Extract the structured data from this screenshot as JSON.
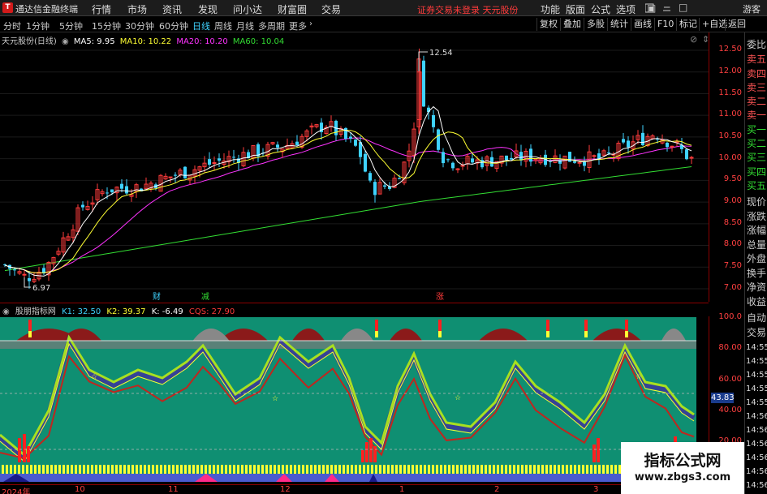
{
  "app": {
    "logo": "T",
    "title": "通达信金融终端"
  },
  "menu": [
    "行情",
    "市场",
    "资讯",
    "发现",
    "问小达",
    "财富圈",
    "交易"
  ],
  "login_status": "证券交易未登录 天元股份",
  "right_menu": [
    "功能",
    "版面",
    "公式",
    "选项"
  ],
  "guest": "游客",
  "periods": [
    "分时",
    "1分钟",
    "5分钟",
    "15分钟",
    "30分钟",
    "60分钟",
    "日线",
    "周线",
    "月线",
    "多周期",
    "更多"
  ],
  "active_period": "日线",
  "tools": [
    "复权",
    "叠加",
    "多股",
    "统计",
    "画线",
    "F10",
    "标记",
    "+自选",
    "返回"
  ],
  "price_legend": {
    "stock": "天元股份(日线)",
    "ma5": "MA5: 9.95",
    "ma10": "MA10: 10.22",
    "ma20": "MA20: 10.20",
    "ma60": "MA60: 10.04"
  },
  "price_axis": [
    "12.50",
    "12.00",
    "11.50",
    "11.00",
    "10.50",
    "10.00",
    "9.50",
    "9.00",
    "8.50",
    "8.00",
    "7.50",
    "7.00"
  ],
  "annotations": {
    "high": "12.54",
    "low": "6.97",
    "marker_cai": "财",
    "marker_jian": "减",
    "marker_zhang": "涨"
  },
  "side_labels": [
    "委比",
    "卖五",
    "卖四",
    "卖三",
    "卖二",
    "卖一",
    "买一",
    "买二",
    "买三",
    "买四",
    "买五",
    "现价",
    "涨跌",
    "涨幅",
    "总量",
    "外盘",
    "换手",
    "净资",
    "收益",
    "自动",
    "交易"
  ],
  "side_times": [
    "14:55",
    "14:55",
    "14:55",
    "14:55",
    "14:55",
    "14:56",
    "14:56",
    "14:56",
    "14:56",
    "14:56",
    "14:56"
  ],
  "indicator_legend": {
    "name": "股朋指标网",
    "k1": "K1: 32.50",
    "k2": "K2: 39.37",
    "k": "K: -6.49",
    "cqs": "CQS: 27.90"
  },
  "indicator_axis": [
    "100.0",
    "80.00",
    "60.00",
    "40.00",
    "20.00"
  ],
  "indicator_current": "43.83",
  "date_axis": [
    "2024年",
    "10",
    "11",
    "12",
    "1",
    "2",
    "3"
  ],
  "watermark": {
    "line1": "指标公式网",
    "line2": "www.zbgs3.com"
  },
  "colors": {
    "up": "#ff3b3b",
    "down": "#3fd3ff",
    "ma5": "#ffffff",
    "ma10": "#ffff33",
    "ma20": "#ff33ff",
    "ma60": "#33dd33",
    "indicator_bg": "#109070"
  },
  "chart_data": {
    "type": "candlestick",
    "title": "天元股份(日线)",
    "y_range": [
      6.8,
      12.7
    ],
    "high_label": 12.54,
    "low_label": 6.97,
    "last_close": 9.95,
    "moving_averages": {
      "MA5": 9.95,
      "MA10": 10.22,
      "MA20": 10.2,
      "MA60": 10.04
    },
    "indicator": {
      "K1": 32.5,
      "K2": 39.37,
      "K": -6.49,
      "CQS": 27.9,
      "y_range": [
        0,
        100
      ]
    }
  }
}
